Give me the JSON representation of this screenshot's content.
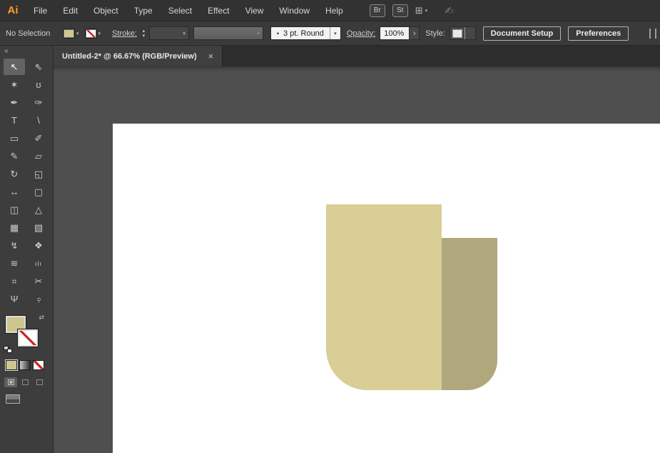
{
  "menubar": {
    "logo": "Ai",
    "items": [
      "File",
      "Edit",
      "Object",
      "Type",
      "Select",
      "Effect",
      "View",
      "Window",
      "Help"
    ],
    "bridge_label": "Br",
    "stock_label": "St",
    "workspace_glyph": "⊞",
    "touch_glyph": "✍",
    "chevron": "▾"
  },
  "control_bar": {
    "selection_status": "No Selection",
    "stroke_label": "Stroke:",
    "stepper_up": "▴",
    "stepper_down": "▾",
    "brush_bullet": "•",
    "brush_value": "3 pt. Round",
    "opacity_label": "Opacity:",
    "opacity_value": "100%",
    "opacity_arrow": "›",
    "style_label": "Style:",
    "document_setup_label": "Document Setup",
    "preferences_label": "Preferences",
    "chevron": "▾"
  },
  "tab_bar": {
    "title": "Untitled-2* @ 66.67% (RGB/Preview)",
    "close": "×"
  },
  "toolbar": {
    "collapse": "«",
    "swap_glyph": "⇄",
    "tools": [
      {
        "name": "selection",
        "glyph": "↖"
      },
      {
        "name": "direct-selection",
        "glyph": "⇖"
      },
      {
        "name": "magic-wand",
        "glyph": "✶"
      },
      {
        "name": "lasso",
        "glyph": "ʊ"
      },
      {
        "name": "pen",
        "glyph": "✒"
      },
      {
        "name": "curvature",
        "glyph": "✑"
      },
      {
        "name": "type",
        "glyph": "T"
      },
      {
        "name": "line-segment",
        "glyph": "\\"
      },
      {
        "name": "rectangle",
        "glyph": "▭"
      },
      {
        "name": "paintbrush",
        "glyph": "✐"
      },
      {
        "name": "shaper",
        "glyph": "✎"
      },
      {
        "name": "eraser",
        "glyph": "▱"
      },
      {
        "name": "rotate",
        "glyph": "↻"
      },
      {
        "name": "scale",
        "glyph": "◱"
      },
      {
        "name": "width",
        "glyph": "↔"
      },
      {
        "name": "free-transform",
        "glyph": "▢"
      },
      {
        "name": "shape-builder",
        "glyph": "◫"
      },
      {
        "name": "perspective-grid",
        "glyph": "△"
      },
      {
        "name": "mesh",
        "glyph": "▦"
      },
      {
        "name": "gradient",
        "glyph": "▧"
      },
      {
        "name": "eyedropper",
        "glyph": "↯"
      },
      {
        "name": "blend",
        "glyph": "❖"
      },
      {
        "name": "symbol-sprayer",
        "glyph": "≋"
      },
      {
        "name": "column-graph",
        "glyph": "ılı"
      },
      {
        "name": "artboard",
        "glyph": "⌗"
      },
      {
        "name": "slice",
        "glyph": "✂"
      },
      {
        "name": "hand",
        "glyph": "Ψ"
      },
      {
        "name": "zoom",
        "glyph": "⌕"
      }
    ]
  },
  "colors": {
    "fill_swatch": "#cfc68f",
    "artwork_light": "#d8ce96",
    "artwork_dark": "#b1a77c",
    "stroke_none_red": "#cc2222"
  }
}
